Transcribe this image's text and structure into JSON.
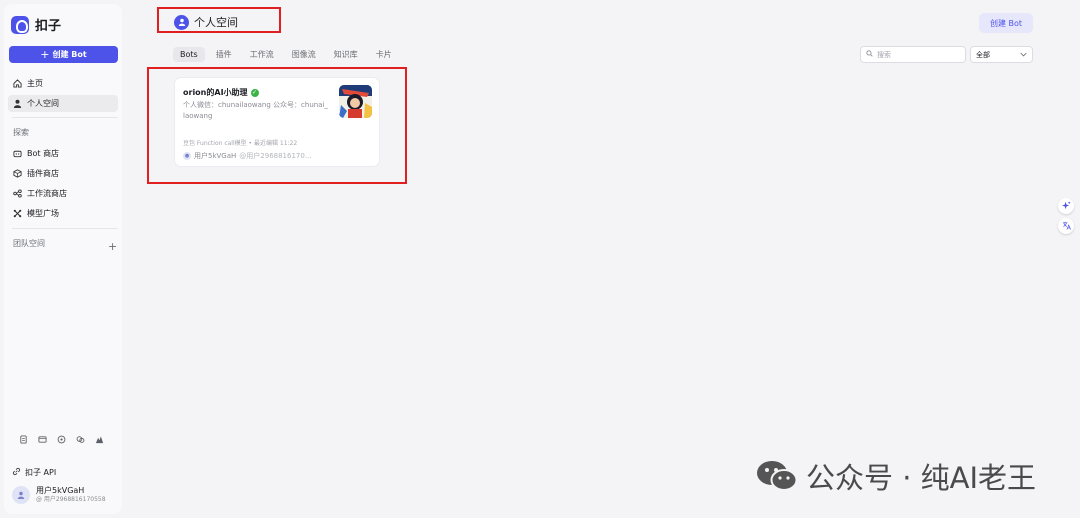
{
  "app": {
    "name": "扣子"
  },
  "sidebar": {
    "create_label": "创建 Bot",
    "nav": [
      {
        "label": "主页",
        "icon": "home-icon"
      },
      {
        "label": "个人空间",
        "icon": "user-icon",
        "active": true
      }
    ],
    "explore_label": "探索",
    "explore": [
      {
        "label": "Bot 商店",
        "icon": "bot-store-icon"
      },
      {
        "label": "插件商店",
        "icon": "plugin-store-icon"
      },
      {
        "label": "工作流商店",
        "icon": "workflow-store-icon"
      },
      {
        "label": "模型广场",
        "icon": "model-square-icon"
      }
    ],
    "team_label": "团队空间",
    "api_label": "扣子 API",
    "user": {
      "name": "用户5kVGaH",
      "id": "@ 用户2968816170558"
    }
  },
  "main": {
    "space_title": "个人空间",
    "create_bot_label": "创建 Bot",
    "tabs": [
      "Bots",
      "插件",
      "工作流",
      "图像流",
      "知识库",
      "卡片"
    ],
    "search_placeholder": "搜索",
    "filter_value": "全部",
    "card": {
      "title": "orion的AI小助理",
      "description": "个人微信：chunailaowang 公众号：chunai_laowang",
      "meta": "豆包 Function call模型 • 最近编辑 11:22",
      "author": "用户5kVGaH",
      "author_handle": "@用户2968816170..."
    }
  },
  "watermark": {
    "text": "公众号 · 纯AI老王"
  },
  "colors": {
    "accent": "#4d53e8",
    "highlight": "#e02020",
    "verified": "#3bb346"
  }
}
